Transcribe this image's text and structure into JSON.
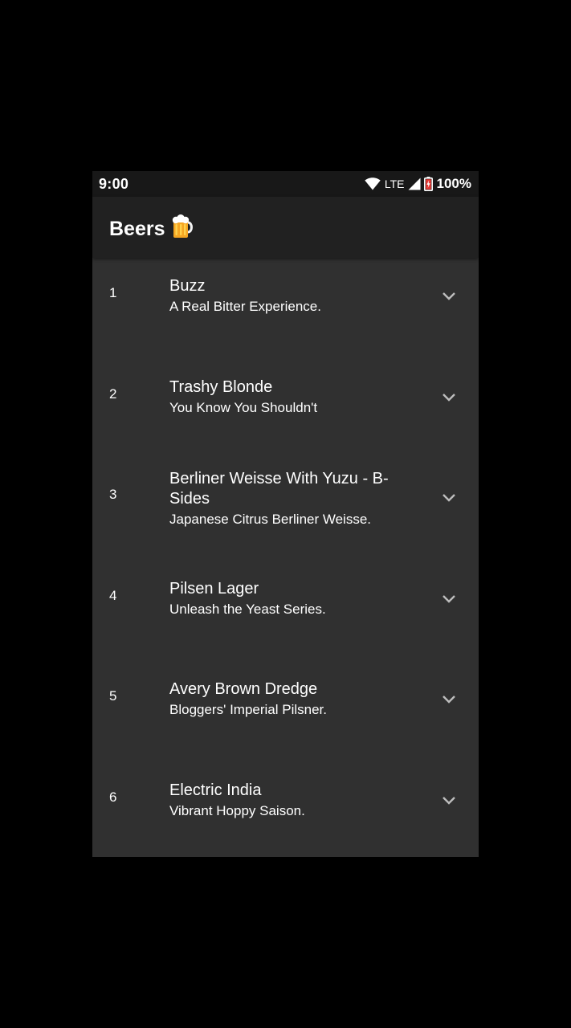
{
  "status_bar": {
    "time": "9:00",
    "network": "LTE",
    "battery": "100%",
    "icons": [
      "wifi-icon",
      "signal-icon",
      "battery-charging-icon"
    ]
  },
  "app_bar": {
    "title": "Beers",
    "icon": "beer-mug-icon"
  },
  "colors": {
    "background": "#000000",
    "surface": "#303030",
    "app_bar": "#212121",
    "status_bar": "#181818",
    "text": "#ffffff",
    "chevron": "#bdbdbd"
  },
  "beers": [
    {
      "number": "1",
      "name": "Buzz",
      "tagline": "A Real Bitter Experience."
    },
    {
      "number": "2",
      "name": "Trashy Blonde",
      "tagline": "You Know You Shouldn't"
    },
    {
      "number": "3",
      "name": "Berliner Weisse With Yuzu - B-Sides",
      "tagline": "Japanese Citrus Berliner Weisse."
    },
    {
      "number": "4",
      "name": "Pilsen Lager",
      "tagline": "Unleash the Yeast Series."
    },
    {
      "number": "5",
      "name": "Avery Brown Dredge",
      "tagline": "Bloggers' Imperial Pilsner."
    },
    {
      "number": "6",
      "name": "Electric India",
      "tagline": "Vibrant Hoppy Saison."
    }
  ]
}
